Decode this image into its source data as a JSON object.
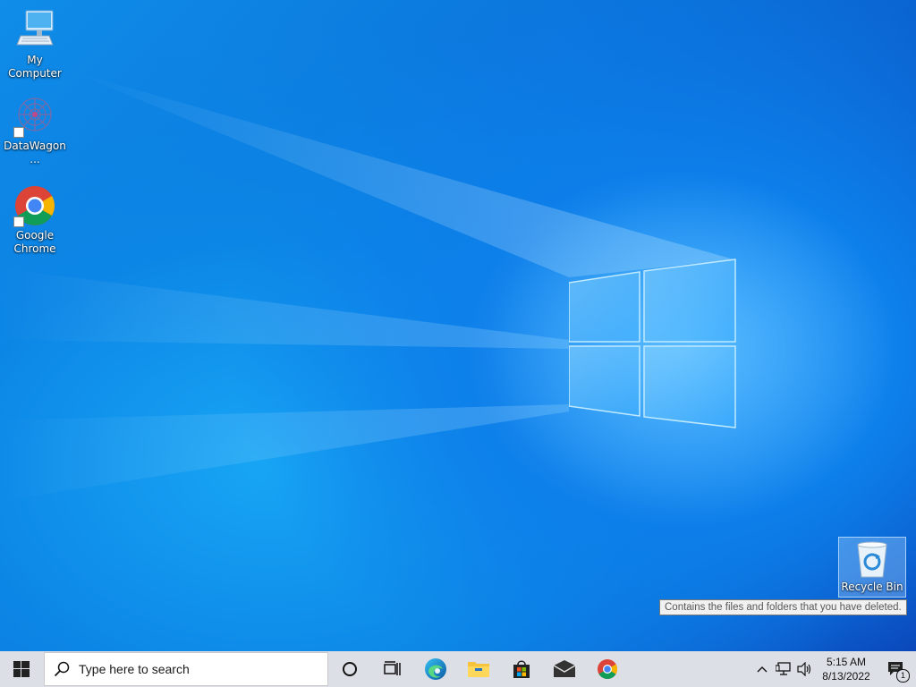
{
  "desktop": {
    "icons": [
      {
        "label": "My Computer",
        "icon": "computer-icon"
      },
      {
        "label": "DataWagon...",
        "icon": "datawagon-icon"
      },
      {
        "label": "Google Chrome",
        "icon": "chrome-icon"
      }
    ],
    "recycle_bin": {
      "label": "Recycle Bin",
      "icon": "recycle-bin-icon"
    },
    "tooltip": "Contains the files and folders that you have deleted."
  },
  "taskbar": {
    "search_placeholder": "Type here to search",
    "pinned": [
      "start-icon",
      "cortana-icon",
      "task-view-icon",
      "edge-icon",
      "file-explorer-icon",
      "store-icon",
      "mail-icon",
      "chrome-icon"
    ],
    "clock": {
      "time": "5:15 AM",
      "date": "8/13/2022"
    },
    "notification_count": "1"
  },
  "colors": {
    "taskbar_bg": "#dcdfe6",
    "desktop_accent": "#0b74dc"
  }
}
